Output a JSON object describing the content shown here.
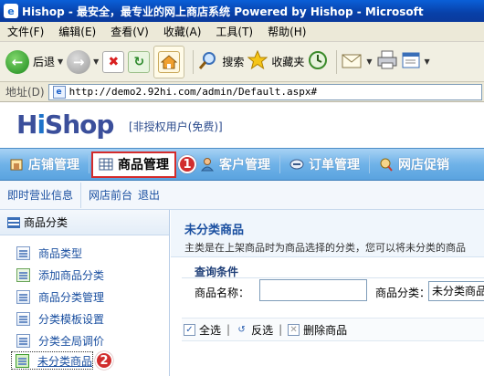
{
  "window": {
    "title": "Hishop - 最安全，最专业的网上商店系统 Powered by Hishop - Microsoft"
  },
  "menubar": {
    "items": [
      "文件(F)",
      "编辑(E)",
      "查看(V)",
      "收藏(A)",
      "工具(T)",
      "帮助(H)"
    ]
  },
  "toolbar": {
    "back_label": "后退",
    "search_label": "搜索",
    "favorites_label": "收藏夹"
  },
  "address": {
    "label": "地址(D)",
    "url": "http://demo2.92hi.com/admin/Default.aspx#"
  },
  "header": {
    "logo_text_1": "H",
    "logo_text_2": "i",
    "logo_text_3": "Shop",
    "user_status": "[非授权用户(免费)]"
  },
  "mainnav": {
    "items": [
      "店铺管理",
      "商品管理",
      "客户管理",
      "订单管理",
      "网店促销"
    ],
    "active_index": 1
  },
  "callouts": [
    "1",
    "2"
  ],
  "subnav": {
    "items": [
      "即时营业信息",
      "网店前台",
      "退出"
    ]
  },
  "sidebar": {
    "header": "商品分类",
    "items": [
      "商品类型",
      "添加商品分类",
      "商品分类管理",
      "分类模板设置",
      "分类全局调价",
      "未分类商品"
    ],
    "selected_index": 5
  },
  "content": {
    "title": "未分类商品",
    "description": "主类是在上架商品时为商品选择的分类，您可以将未分类的商品",
    "query_title": "查询条件",
    "name_label": "商品名称：",
    "name_value": "",
    "category_label": "商品分类：",
    "category_value": "未分类商品",
    "actions": [
      "全选",
      "反选",
      "删除商品"
    ]
  },
  "colors": {
    "accent": "#d42b2b",
    "nav_blue": "#5aa3df",
    "link_blue": "#1a4fa0"
  }
}
